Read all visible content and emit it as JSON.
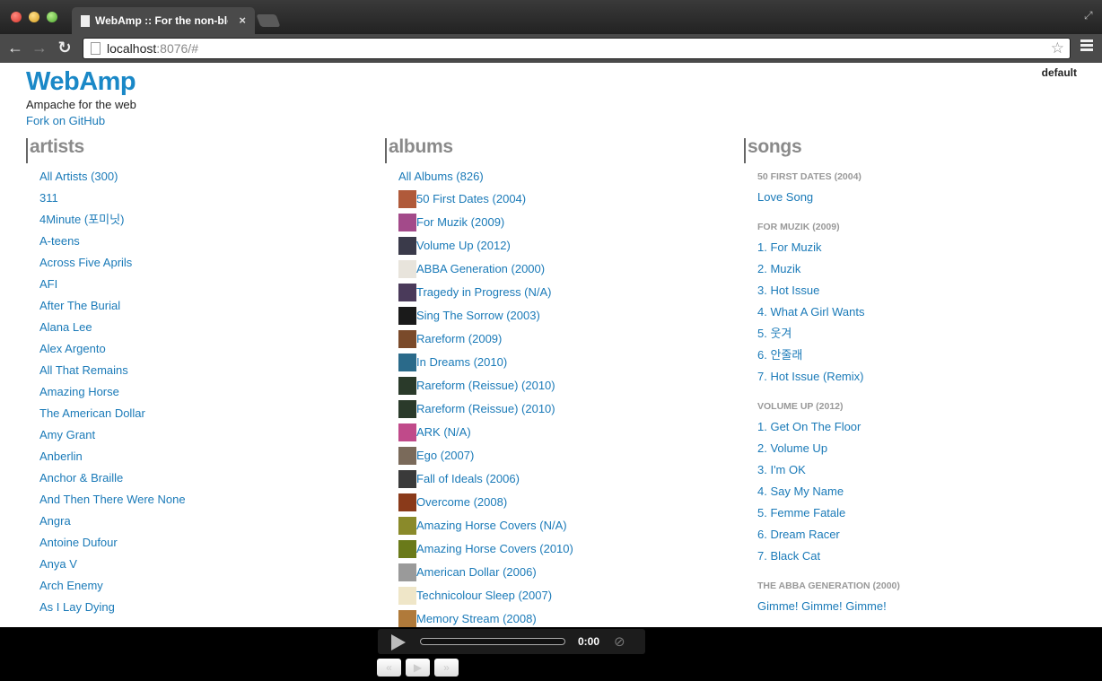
{
  "browser": {
    "tab_title": "WebAmp :: For the non-blocking",
    "tab_close": "×",
    "url_host": "localhost",
    "url_rest": ":8076/#"
  },
  "header": {
    "logo": "WebAmp",
    "tagline": "Ampache for the web",
    "fork_link": "Fork on GitHub",
    "user": "default"
  },
  "artists": {
    "heading": "artists",
    "items": [
      "All Artists (300)",
      "311",
      "4Minute (포미닛)",
      "A-teens",
      "Across Five Aprils",
      "AFI",
      "After The Burial",
      "Alana Lee",
      "Alex Argento",
      "All That Remains",
      "Amazing Horse",
      "The American Dollar",
      "Amy Grant",
      "Anberlin",
      "Anchor & Braille",
      "And Then There Were None",
      "Angra",
      "Antoine Dufour",
      "Anya V",
      "Arch Enemy",
      "As I Lay Dying"
    ]
  },
  "albums": {
    "heading": "albums",
    "all": "All Albums (826)",
    "items": [
      {
        "label": "50 First Dates (2004)",
        "color": "#b05a3a"
      },
      {
        "label": "For Muzik (2009)",
        "color": "#a34a8a"
      },
      {
        "label": "Volume Up (2012)",
        "color": "#3a3a4a"
      },
      {
        "label": "ABBA Generation (2000)",
        "color": "#e8e4dc"
      },
      {
        "label": "Tragedy in Progress (N/A)",
        "color": "#4a3a5a"
      },
      {
        "label": "Sing The Sorrow (2003)",
        "color": "#1a1a1a"
      },
      {
        "label": "Rareform (2009)",
        "color": "#7a4a2a"
      },
      {
        "label": "In Dreams (2010)",
        "color": "#2a6a8a"
      },
      {
        "label": "Rareform (Reissue) (2010)",
        "color": "#2a3a2a"
      },
      {
        "label": "Rareform (Reissue) (2010)",
        "color": "#2a3a2a"
      },
      {
        "label": "ARK (N/A)",
        "color": "#c04a8a"
      },
      {
        "label": "Ego (2007)",
        "color": "#7a6a5a"
      },
      {
        "label": "Fall of Ideals (2006)",
        "color": "#3a3a3a"
      },
      {
        "label": "Overcome (2008)",
        "color": "#8a3a1a"
      },
      {
        "label": "Amazing Horse Covers (N/A)",
        "color": "#8a8a2a"
      },
      {
        "label": "Amazing Horse Covers (2010)",
        "color": "#6a7a1a"
      },
      {
        "label": "American Dollar (2006)",
        "color": "#9a9a9a"
      },
      {
        "label": "Technicolour Sleep (2007)",
        "color": "#efe6c8"
      },
      {
        "label": "Memory Stream (2008)",
        "color": "#b07a3a"
      }
    ]
  },
  "songs": {
    "heading": "songs",
    "groups": [
      {
        "title": "50 FIRST DATES",
        "year": "(2004)",
        "songs": [
          "Love Song"
        ]
      },
      {
        "title": "FOR MUZIK",
        "year": "(2009)",
        "songs": [
          "1. For Muzik",
          "2. Muzik",
          "3. Hot Issue",
          "4. What A Girl Wants",
          "5. 웃겨",
          "6. 안줄래",
          "7. Hot Issue (Remix)"
        ]
      },
      {
        "title": "VOLUME UP",
        "year": "(2012)",
        "songs": [
          "1. Get On The Floor",
          "2. Volume Up",
          "3. I'm OK",
          "4. Say My Name",
          "5. Femme Fatale",
          "6. Dream Racer",
          "7. Black Cat"
        ]
      },
      {
        "title": "THE ABBA GENERATION",
        "year": "(2000)",
        "songs": [
          "Gimme! Gimme! Gimme!"
        ]
      }
    ]
  },
  "player": {
    "time": "0:00",
    "progress": 0,
    "prev": "«",
    "play": "▶",
    "next": "»"
  }
}
